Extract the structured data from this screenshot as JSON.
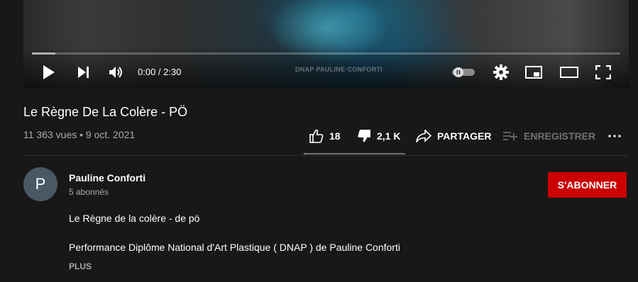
{
  "player": {
    "current_time": "0:00 / 2:30",
    "watermark": "DNAP PAULINE·CONFORTI",
    "progress_fraction": 0.04,
    "icons": [
      "play-icon",
      "next-icon",
      "volume-icon",
      "autoplay-toggle-icon",
      "gear-icon",
      "miniplayer-icon",
      "theater-mode-icon",
      "fullscreen-icon"
    ]
  },
  "video": {
    "title": "Le Règne De La Colère - PÖ",
    "views_date": "11 363 vues • 9 oct. 2021"
  },
  "actions": {
    "like_count": "18",
    "dislike_count": "2,1 K",
    "share_label": "PARTAGER",
    "save_label": "ENREGISTRER",
    "like_fraction": 0.0085
  },
  "channel": {
    "avatar_letter": "P",
    "name": "Pauline Conforti",
    "subscribers": "5 abonnés",
    "subscribe_label": "S'ABONNER"
  },
  "description": {
    "line1": "Le Règne de la colère - de pö",
    "line2": "Performance Diplôme National d'Art Plastique ( DNAP ) de Pauline Conforti",
    "more_label": "PLUS"
  },
  "colors": {
    "background": "#181818",
    "subscribe": "#cc0000",
    "secondary_text": "#aaaaaa"
  }
}
